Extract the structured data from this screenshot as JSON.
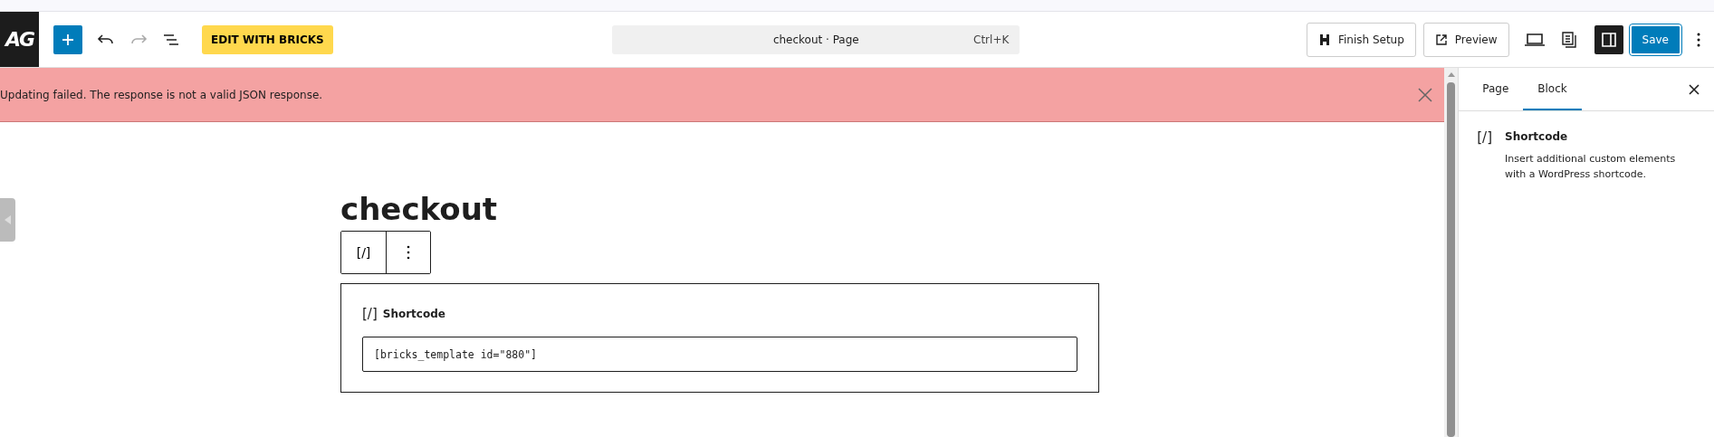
{
  "toolbar": {
    "logo_text": "AG",
    "edit_button": "EDIT WITH BRICKS",
    "redo_disabled": true,
    "command_bar": {
      "title": "checkout · Page",
      "shortcut": "Ctrl+K"
    },
    "finish_setup": "Finish Setup",
    "preview": "Preview",
    "sidebar_toggle_on": true,
    "save": "Save"
  },
  "notice": {
    "message": "Updating failed. The response is not a valid JSON response."
  },
  "editor": {
    "title": "checkout",
    "block_icon_text": "[/]",
    "block": {
      "icon_text": "[/]",
      "label": "Shortcode",
      "value": "[bricks_template id=\"880\"]"
    }
  },
  "sidebar": {
    "tabs": [
      {
        "label": "Page",
        "selected": false
      },
      {
        "label": "Block",
        "selected": true
      }
    ],
    "block_icon_text": "[/]",
    "block_name": "Shortcode",
    "block_description": "Insert additional custom elements with a WordPress shortcode."
  }
}
